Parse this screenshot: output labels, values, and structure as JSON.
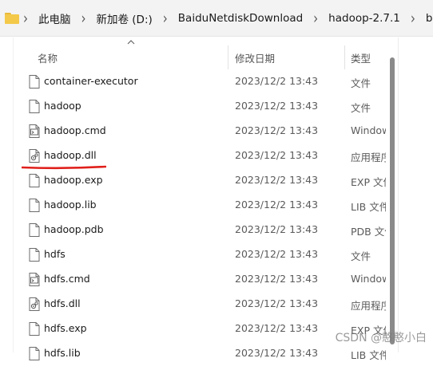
{
  "breadcrumb": {
    "items": [
      "此电脑",
      "新加卷 (D:)",
      "BaiduNetdiskDownload",
      "hadoop-2.7.1",
      "bin"
    ],
    "separator": "›"
  },
  "columns": {
    "name": "名称",
    "modified": "修改日期",
    "type": "类型"
  },
  "files": [
    {
      "name": "container-executor",
      "modified": "2023/12/2 13:43",
      "type": "文件",
      "icon": "blank-file-icon"
    },
    {
      "name": "hadoop",
      "modified": "2023/12/2 13:43",
      "type": "文件",
      "icon": "blank-file-icon"
    },
    {
      "name": "hadoop.cmd",
      "modified": "2023/12/2 13:43",
      "type": "Windows",
      "icon": "cmd-file-icon"
    },
    {
      "name": "hadoop.dll",
      "modified": "2023/12/2 13:43",
      "type": "应用程序",
      "icon": "dll-file-icon"
    },
    {
      "name": "hadoop.exp",
      "modified": "2023/12/2 13:43",
      "type": "EXP 文件",
      "icon": "blank-file-icon"
    },
    {
      "name": "hadoop.lib",
      "modified": "2023/12/2 13:43",
      "type": "LIB 文件",
      "icon": "blank-file-icon"
    },
    {
      "name": "hadoop.pdb",
      "modified": "2023/12/2 13:43",
      "type": "PDB 文件",
      "icon": "blank-file-icon"
    },
    {
      "name": "hdfs",
      "modified": "2023/12/2 13:43",
      "type": "文件",
      "icon": "blank-file-icon"
    },
    {
      "name": "hdfs.cmd",
      "modified": "2023/12/2 13:43",
      "type": "Windows",
      "icon": "cmd-file-icon"
    },
    {
      "name": "hdfs.dll",
      "modified": "2023/12/2 13:43",
      "type": "应用程序",
      "icon": "dll-file-icon"
    },
    {
      "name": "hdfs.exp",
      "modified": "2023/12/2 13:43",
      "type": "EXP 文件",
      "icon": "blank-file-icon"
    },
    {
      "name": "hdfs.lib",
      "modified": "2023/12/2 13:43",
      "type": "LIB 文件",
      "icon": "blank-file-icon"
    }
  ],
  "watermark": "CSDN @憨憨小白",
  "colors": {
    "folder": "#f4c949",
    "annotation": "#e0201b",
    "scrollbar": "#8a8a8a"
  }
}
